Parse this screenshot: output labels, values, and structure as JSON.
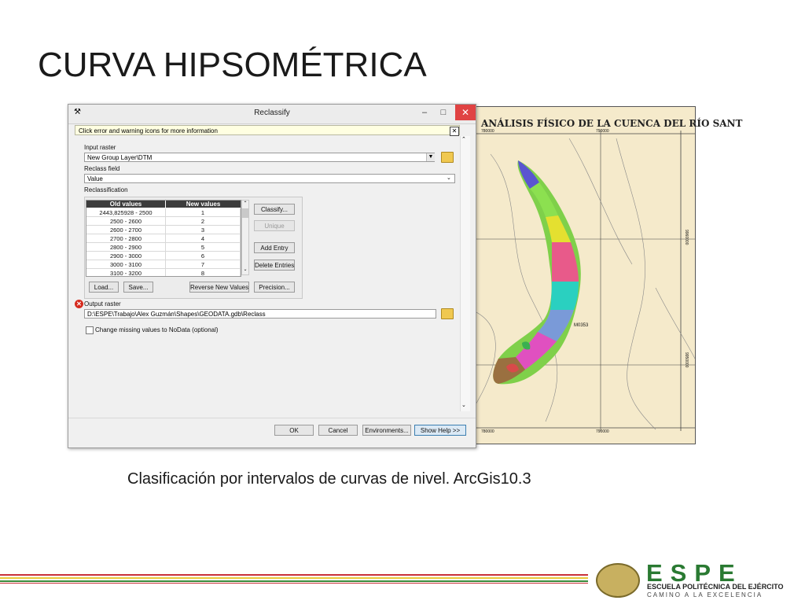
{
  "slide": {
    "title": "CURVA HIPSOMÉTRICA",
    "caption": "Clasificación por intervalos de curvas de nivel.  ArcGis10.3"
  },
  "map": {
    "title": "ANÁLISIS FÍSICO DE LA CUENCA DEL RÍO SANT",
    "coord_top_left": "780000",
    "coord_top_right": "790000",
    "coord_bottom_left": "780000",
    "coord_bottom_right": "790000",
    "coord_right_1": "9960000",
    "coord_right_2": "9950000",
    "point_label": "M0353"
  },
  "dialog": {
    "title": "Reclassify",
    "info_bar": "Click error and warning icons for more information",
    "input_raster_label": "Input raster",
    "input_raster_value": "New Group Layer\\DTM",
    "reclass_field_label": "Reclass field",
    "reclass_field_value": "Value",
    "reclassification_label": "Reclassification",
    "table_headers": [
      "Old values",
      "New values"
    ],
    "table_rows": [
      {
        "old": "2443,825928 - 2500",
        "new": "1"
      },
      {
        "old": "2500 - 2600",
        "new": "2"
      },
      {
        "old": "2600 - 2700",
        "new": "3"
      },
      {
        "old": "2700 - 2800",
        "new": "4"
      },
      {
        "old": "2800 - 2900",
        "new": "5"
      },
      {
        "old": "2900 - 3000",
        "new": "6"
      },
      {
        "old": "3000 - 3100",
        "new": "7"
      },
      {
        "old": "3100 - 3200",
        "new": "8"
      }
    ],
    "buttons": {
      "classify": "Classify...",
      "unique": "Unique",
      "add_entry": "Add Entry",
      "delete_entries": "Delete Entries",
      "load": "Load...",
      "save": "Save...",
      "reverse": "Reverse New Values",
      "precision": "Precision...",
      "ok": "OK",
      "cancel": "Cancel",
      "environments": "Environments...",
      "show_help": "Show Help >>"
    },
    "output_raster_label": "Output raster",
    "output_raster_value": "D:\\ESPE\\Trabajo\\Alex Guzmán\\Shapes\\GEODATA.gdb\\Reclass",
    "nodata_label": "Change missing values to NoData (optional)"
  },
  "logo": {
    "word": "ESPE",
    "sub1": "ESCUELA POLITÉCNICA DEL EJÉRCITO",
    "sub2": "CAMINO A LA EXCELENCIA"
  },
  "colors": {
    "map_background": "#f5eacb",
    "stripe_red": "#c8323a",
    "stripe_yellow": "#e8c83a",
    "stripe_green": "#3a8a3a",
    "brand_green": "#2a7a32"
  }
}
